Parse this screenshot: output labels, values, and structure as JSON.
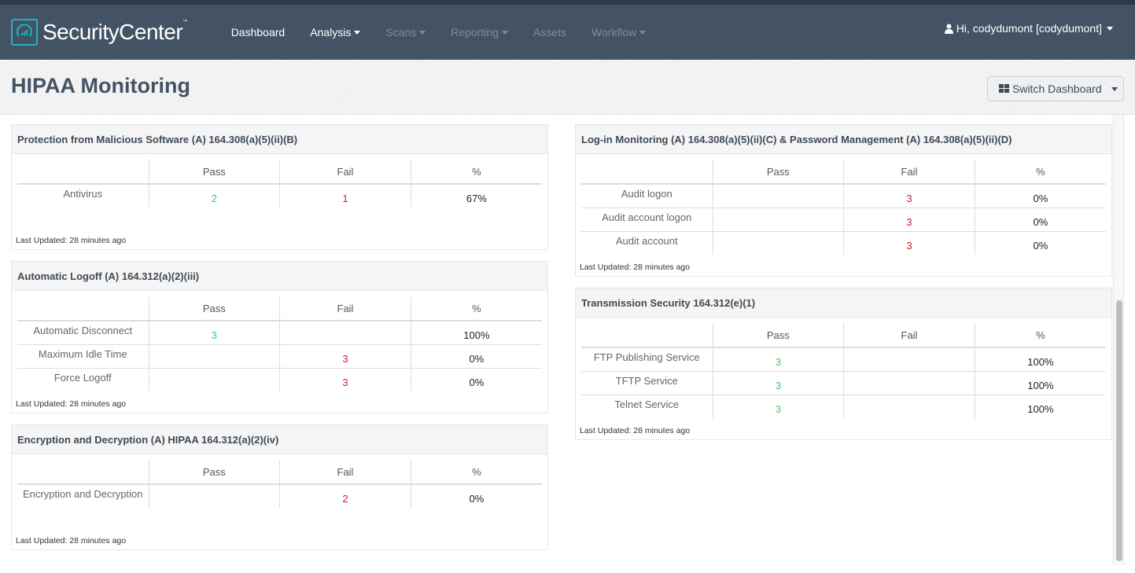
{
  "app": {
    "brand": "SecurityCenter",
    "tm": "™",
    "nav": [
      {
        "label": "Dashboard",
        "caret": false,
        "enabled": true
      },
      {
        "label": "Analysis",
        "caret": true,
        "enabled": true
      },
      {
        "label": "Scans",
        "caret": true,
        "enabled": false
      },
      {
        "label": "Reporting",
        "caret": true,
        "enabled": false
      },
      {
        "label": "Assets",
        "caret": false,
        "enabled": false
      },
      {
        "label": "Workflow",
        "caret": true,
        "enabled": false
      }
    ],
    "user": "Hi, codydumont [codydumont]"
  },
  "header": {
    "title": "HIPAA Monitoring",
    "switch_label": "Switch Dashboard"
  },
  "colors": {
    "pass": "#3fcd5a",
    "fail": "#c8202a",
    "accent": "#1fb3bf",
    "navbar": "#435363"
  },
  "columns": {
    "name": "",
    "pass": "Pass",
    "fail": "Fail",
    "pct": "%"
  },
  "panels": {
    "malware": {
      "title": "Protection from Malicious Software (A) 164.308(a)(5)(ii)(B)",
      "rows": [
        {
          "name": "Antivirus",
          "pass": "2",
          "fail": "1",
          "pct": "67%"
        }
      ],
      "updated": "Last Updated: 28 minutes ago"
    },
    "logoff": {
      "title": "Automatic Logoff (A) 164.312(a)(2)(iii)",
      "rows": [
        {
          "name": "Automatic Disconnect",
          "pass": "3",
          "fail": "",
          "pct": "100%"
        },
        {
          "name": "Maximum Idle Time",
          "pass": "",
          "fail": "3",
          "pct": "0%"
        },
        {
          "name": "Force Logoff",
          "pass": "",
          "fail": "3",
          "pct": "0%"
        }
      ],
      "updated": "Last Updated: 28 minutes ago"
    },
    "encryption": {
      "title": "Encryption and Decryption (A) HIPAA 164.312(a)(2)(iv)",
      "rows": [
        {
          "name": "Encryption and Decryption",
          "pass": "",
          "fail": "2",
          "pct": "0%"
        }
      ],
      "updated": "Last Updated: 28 minutes ago"
    },
    "login": {
      "title": "Log-in Monitoring (A) 164.308(a)(5)(ii)(C) & Password Management (A) 164.308(a)(5)(ii)(D)",
      "rows": [
        {
          "name": "Audit logon",
          "pass": "",
          "fail": "3",
          "pct": "0%"
        },
        {
          "name": "Audit account logon",
          "pass": "",
          "fail": "3",
          "pct": "0%"
        },
        {
          "name": "Audit account",
          "pass": "",
          "fail": "3",
          "pct": "0%"
        }
      ],
      "updated": "Last Updated: 28 minutes ago"
    },
    "transmission": {
      "title": "Transmission Security 164.312(e)(1)",
      "rows": [
        {
          "name": "FTP Publishing Service",
          "pass": "3",
          "fail": "",
          "pct": "100%"
        },
        {
          "name": "TFTP Service",
          "pass": "3",
          "fail": "",
          "pct": "100%"
        },
        {
          "name": "Telnet Service",
          "pass": "3",
          "fail": "",
          "pct": "100%"
        }
      ],
      "updated": "Last Updated: 28 minutes ago"
    }
  }
}
